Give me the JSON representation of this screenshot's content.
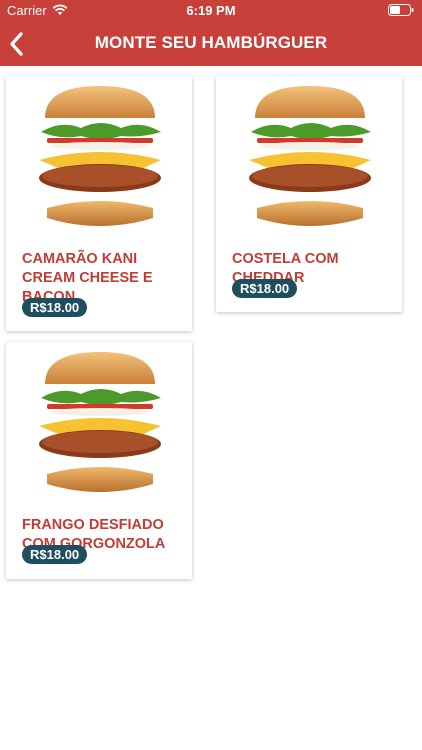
{
  "status": {
    "carrier": "Carrier",
    "time": "6:19 PM"
  },
  "header": {
    "title": "MONTE SEU HAMBÚRGUER"
  },
  "colors": {
    "header_bg": "#c8403a",
    "name_text": "#c23c36",
    "price_bg": "#1f4e5f"
  },
  "products": [
    {
      "name": "CAMARÃO KANI CREAM CHEESE E BACON",
      "price": "R$18.00",
      "image": "burger-image"
    },
    {
      "name": "COSTELA COM CHEDDAR",
      "price": "R$18.00",
      "image": "burger-image"
    },
    {
      "name": "FRANGO DESFIADO COM GORGONZOLA",
      "price": "R$18.00",
      "image": "burger-image"
    }
  ]
}
